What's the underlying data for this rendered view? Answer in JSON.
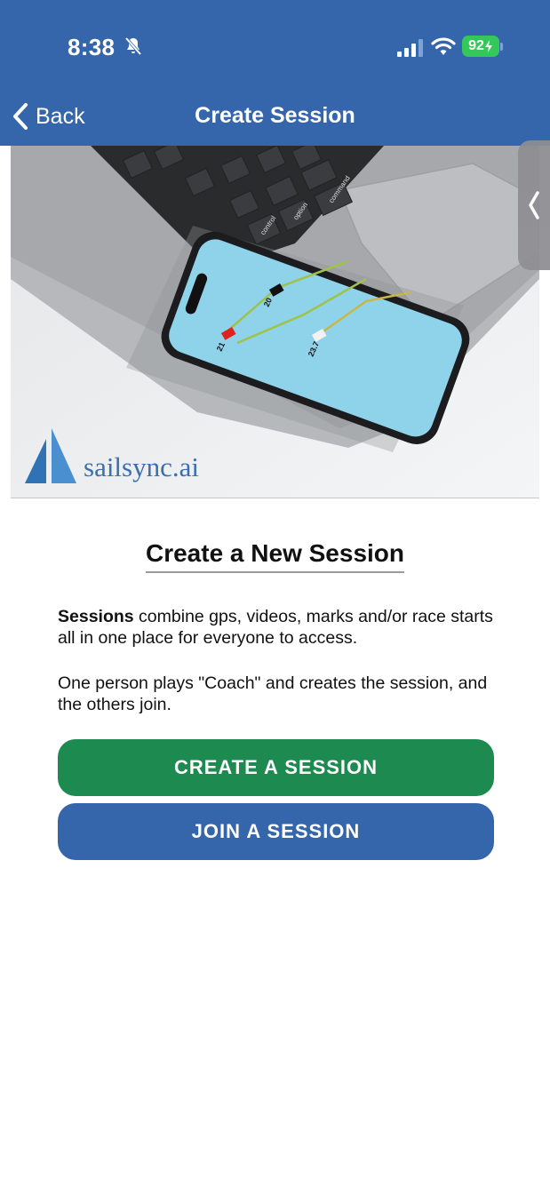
{
  "status_bar": {
    "time": "8:38",
    "battery": "92"
  },
  "nav": {
    "back_label": "Back",
    "title": "Create Session"
  },
  "hero": {
    "brand_name": "sailsync.ai",
    "boat_labels": [
      "20",
      "21",
      "23.7"
    ],
    "keyboard_labels": [
      "command",
      "option",
      "control"
    ]
  },
  "content": {
    "heading": "Create a New Session",
    "para1_bold": "Sessions",
    "para1_rest": " combine gps, videos, marks and/or race starts all in one place for everyone to access.",
    "para2": "One person plays \"Coach\" and creates the session, and the others join."
  },
  "buttons": {
    "create": "CREATE A SESSION",
    "join": "JOIN A SESSION"
  },
  "colors": {
    "header": "#3565aa",
    "create_button": "#1d8a50",
    "join_button": "#3565aa",
    "battery": "#34c759"
  },
  "icons": {
    "bell_off": "bell-slash",
    "signal": "cellular-signal",
    "wifi": "wifi",
    "battery": "battery-charging",
    "back": "chevron-left",
    "side_tab": "chevron-left"
  }
}
